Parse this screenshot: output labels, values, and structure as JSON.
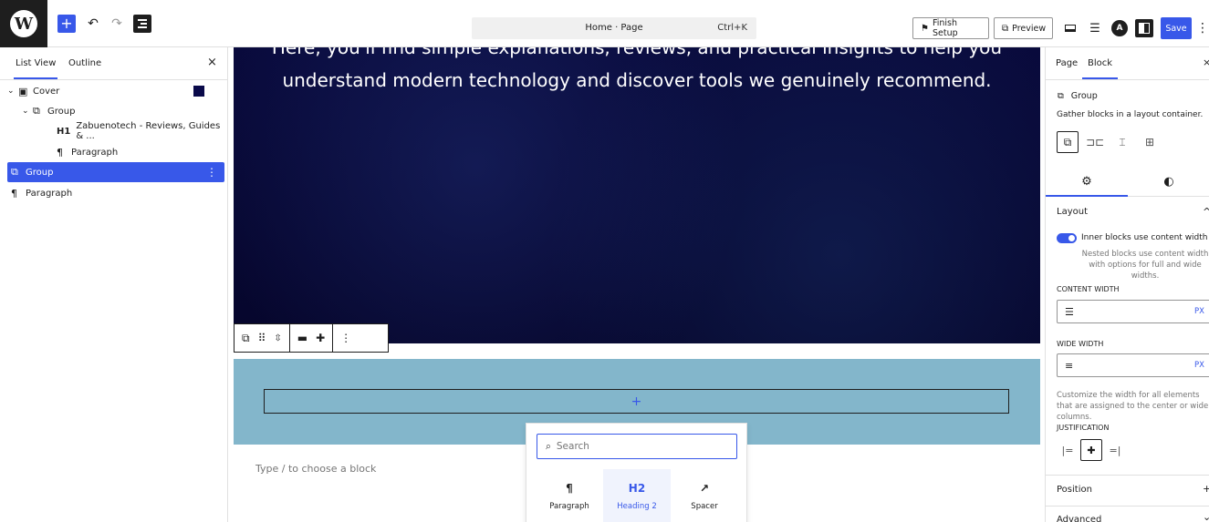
{
  "toolbar": {
    "logo_glyph": "W",
    "add_glyph": "+",
    "undo_glyph": "↶",
    "redo_glyph": "↷",
    "doc_title": "Home · Page",
    "shortcut": "Ctrl+K",
    "finish_setup_label": "Finish Setup",
    "preview_label": "Preview",
    "astra_glyph": "A",
    "save_label": "Save",
    "more_glyph": "⋮"
  },
  "listview": {
    "tabs": [
      "List View",
      "Outline"
    ],
    "close_glyph": "×",
    "items": [
      {
        "label": "Cover",
        "level": 0,
        "icon": "▣"
      },
      {
        "label": "Group",
        "level": 1,
        "icon": "⧉"
      },
      {
        "heading": "H1",
        "label": "Zabuenotech - Reviews, Guides & ...",
        "level": 2
      },
      {
        "label": "Paragraph",
        "level": 2,
        "icon": "¶"
      },
      {
        "label": "Group",
        "level": 0,
        "icon": "⧉"
      },
      {
        "label": "Paragraph",
        "level": 0,
        "icon": "¶"
      }
    ],
    "kebab_glyph": "⋮"
  },
  "canvas": {
    "cover_text": "Here, you'll find simple explanations, reviews, and practical insights to help you understand modern technology and discover tools we genuinely recommend.",
    "appender_glyph": "+",
    "placeholder": "Type / to choose a block",
    "inserter": {
      "search_placeholder": "Search",
      "items": [
        {
          "label": "Paragraph",
          "glyph": "¶"
        },
        {
          "label": "Heading 2",
          "glyph": "H2"
        },
        {
          "label": "Spacer",
          "glyph": "↗"
        }
      ]
    }
  },
  "sidebar": {
    "tabs": [
      "Page",
      "Block"
    ],
    "close_glyph": "×",
    "block_name": "Group",
    "block_description": "Gather blocks in a layout container.",
    "layout_title": "Layout",
    "toggle_label": "Inner blocks use content width",
    "toggle_help": "Nested blocks use content width with options for full and wide widths.",
    "content_width_label": "CONTENT WIDTH",
    "wide_width_label": "WIDE WIDTH",
    "unit": "PX",
    "width_help": "Customize the width for all elements that are assigned to the center or wide columns.",
    "justification_label": "JUSTIFICATION",
    "position_label": "Position",
    "advanced_label": "Advanced",
    "plus_glyph": "+",
    "chevron_up_glyph": "^",
    "chevron_down_glyph": "⌄"
  }
}
